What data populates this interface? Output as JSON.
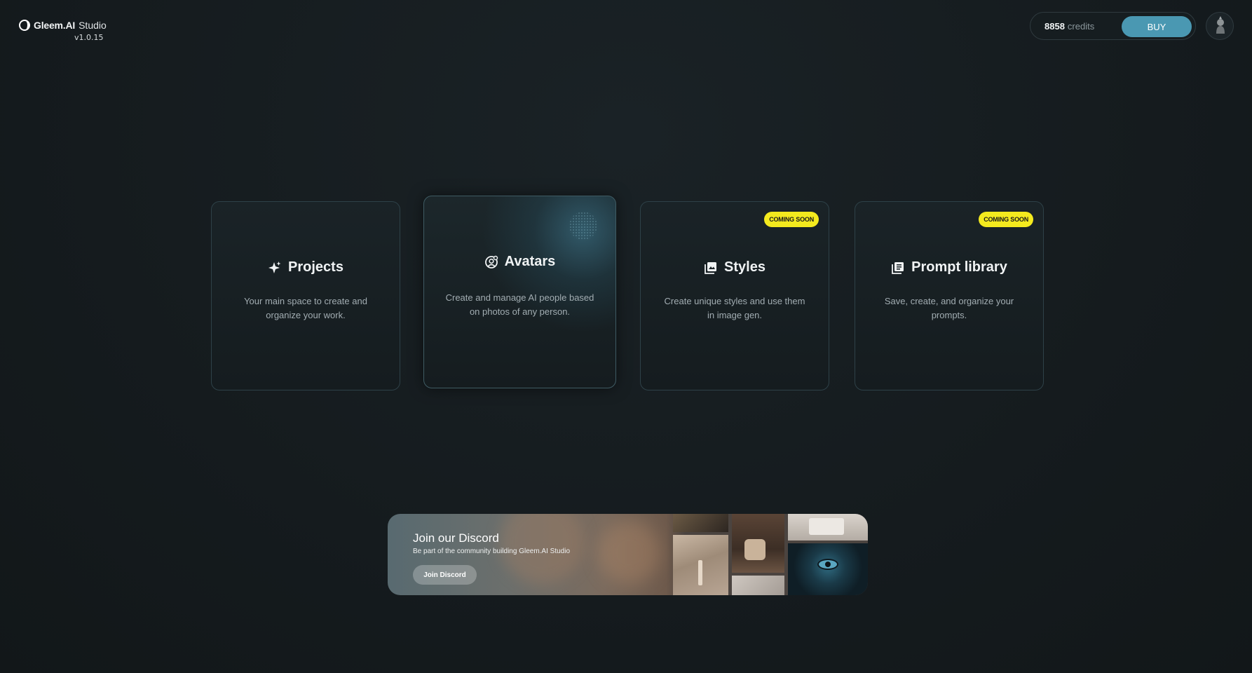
{
  "header": {
    "brand": "Gleem.AI",
    "brand_suffix": "Studio",
    "version": "v1.0.15",
    "credits_value": "8858",
    "credits_label": "credits",
    "buy_label": "BUY"
  },
  "cards": [
    {
      "title": "Projects",
      "description": "Your main space to create and organize your work.",
      "icon": "sparkle-icon",
      "badge": ""
    },
    {
      "title": "Avatars",
      "description": "Create and manage AI people based on photos of any person.",
      "icon": "avatar-icon",
      "badge": ""
    },
    {
      "title": "Styles",
      "description": "Create unique styles and use them in image gen.",
      "icon": "image-stack-icon",
      "badge": "COMING SOON"
    },
    {
      "title": "Prompt library",
      "description": "Save, create, and organize your prompts.",
      "icon": "library-icon",
      "badge": "COMING SOON"
    }
  ],
  "discord": {
    "title": "Join our Discord",
    "subtitle": "Be part of the community building Gleem.AI Studio",
    "button_label": "Join Discord"
  },
  "colors": {
    "accent": "#4a98b2",
    "badge": "#f4ea1e",
    "background": "#151b1e"
  }
}
